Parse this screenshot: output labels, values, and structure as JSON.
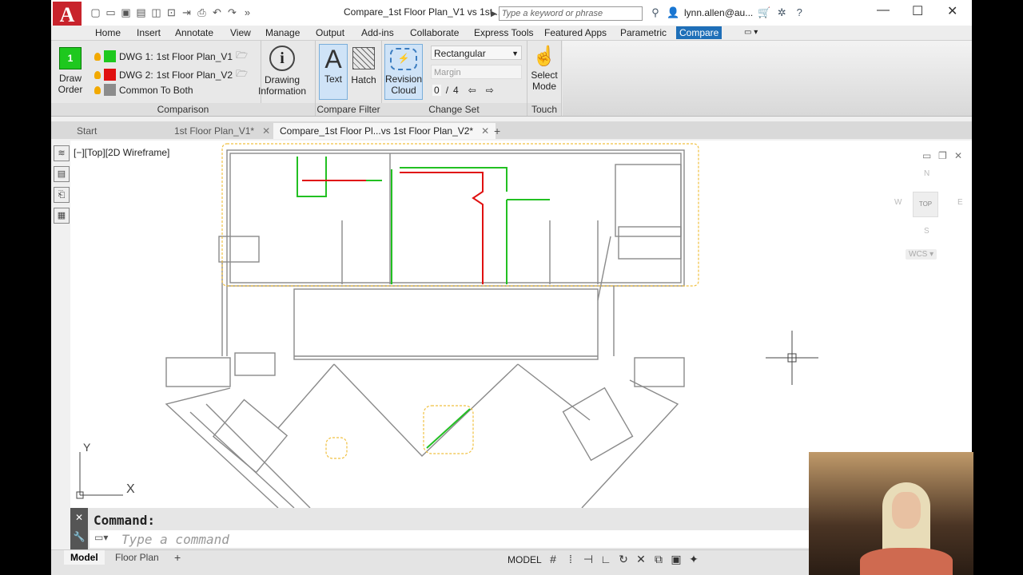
{
  "app": {
    "logo_letter": "A",
    "title": "Compare_1st Floor Plan_V1 vs 1st...",
    "search_placeholder": "Type a keyword or phrase",
    "user": "lynn.allen@au..."
  },
  "menu_tabs": [
    "Home",
    "Insert",
    "Annotate",
    "View",
    "Manage",
    "Output",
    "Add-ins",
    "Collaborate",
    "Express Tools",
    "Featured Apps",
    "Parametric",
    "Compare"
  ],
  "active_menu_tab": "Compare",
  "ribbon": {
    "draw_order": {
      "line1": "Draw",
      "line2": "Order"
    },
    "dwg1": {
      "label": "DWG 1:",
      "file": "1st Floor Plan_V1",
      "color": "#1ec81e"
    },
    "dwg2": {
      "label": "DWG 2:",
      "file": "1st Floor Plan_V2",
      "color": "#e01010"
    },
    "common": {
      "label": "Common To Both",
      "color": "#8c8c8c"
    },
    "drawing_info": {
      "line1": "Drawing",
      "line2": "Information"
    },
    "comparison_title": "Comparison",
    "text_btn": "Text",
    "hatch_btn": "Hatch",
    "revision_cloud": {
      "line1": "Revision",
      "line2": "Cloud"
    },
    "compare_filter_title": "Compare Filter",
    "shape_select": "Rectangular",
    "margin_label": "Margin",
    "change_index": "0",
    "change_sep": "/",
    "change_total": "4",
    "change_set_title": "Change Set",
    "select_mode": {
      "line1": "Select",
      "line2": "Mode"
    },
    "touch_title": "Touch"
  },
  "doc_tabs": [
    {
      "label": "Start"
    },
    {
      "label": "1st Floor Plan_V1*"
    },
    {
      "label": "Compare_1st Floor Pl...vs 1st Floor Plan_V2*"
    }
  ],
  "viewport": {
    "view_label": "[−][Top][2D Wireframe]",
    "compass": {
      "n": "N",
      "s": "S",
      "e": "E",
      "w": "W",
      "top": "TOP"
    },
    "wcs": "WCS",
    "ucs_x": "X",
    "ucs_y": "Y"
  },
  "command": {
    "title": "Command:",
    "placeholder": "Type a command"
  },
  "layout_tabs": [
    "Model",
    "Floor Plan"
  ],
  "status": {
    "model": "MODEL"
  },
  "colors": {
    "accent": "#1e6fb8",
    "green": "#1ec81e",
    "red": "#e01010",
    "cloud": "#f0c040"
  }
}
